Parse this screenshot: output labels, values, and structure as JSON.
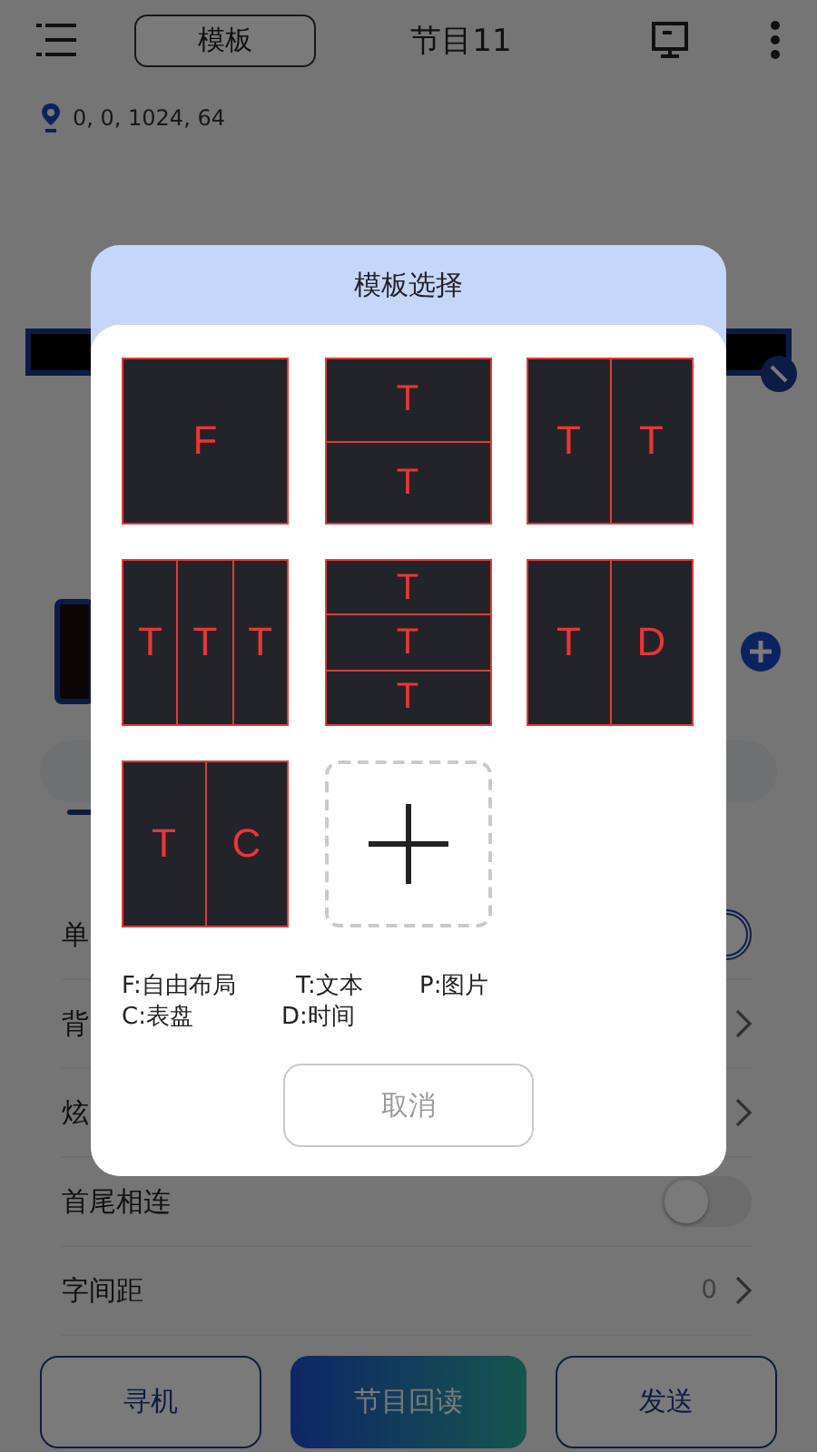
{
  "top_bar": {
    "template_button": "模板",
    "title": "节目11"
  },
  "location": "0, 0, 1024, 64",
  "settings": [
    {
      "label": "单",
      "kind": "toggle",
      "on": true
    },
    {
      "label": "背",
      "kind": "chevron"
    },
    {
      "label": "炫",
      "kind": "chevron"
    },
    {
      "label": "首尾相连",
      "kind": "toggle",
      "on": false
    },
    {
      "label": "字间距",
      "kind": "value",
      "value": "0"
    }
  ],
  "bottom_buttons": [
    {
      "label": "寻机",
      "kind": "outline"
    },
    {
      "label": "节目回读",
      "kind": "gradient"
    },
    {
      "label": "发送",
      "kind": "outline"
    }
  ],
  "dialog": {
    "title": "模板选择",
    "templates": [
      {
        "kind": "single",
        "cells": [
          "F"
        ]
      },
      {
        "kind": "rows",
        "cells": [
          "T",
          "T"
        ]
      },
      {
        "kind": "cols",
        "cells": [
          "T",
          "T"
        ]
      },
      {
        "kind": "cols",
        "cells": [
          "T",
          "T",
          "T"
        ]
      },
      {
        "kind": "rows",
        "cells": [
          "T",
          "T",
          "T"
        ]
      },
      {
        "kind": "cols",
        "cells": [
          "T",
          "D"
        ]
      },
      {
        "kind": "cols",
        "cells": [
          "T",
          "C"
        ]
      },
      {
        "kind": "add"
      }
    ],
    "legend": [
      [
        "F:自由布局",
        "T:文本",
        "P:图片"
      ],
      [
        "C:表盘",
        "D:时间"
      ]
    ],
    "cancel_button": "取消"
  }
}
